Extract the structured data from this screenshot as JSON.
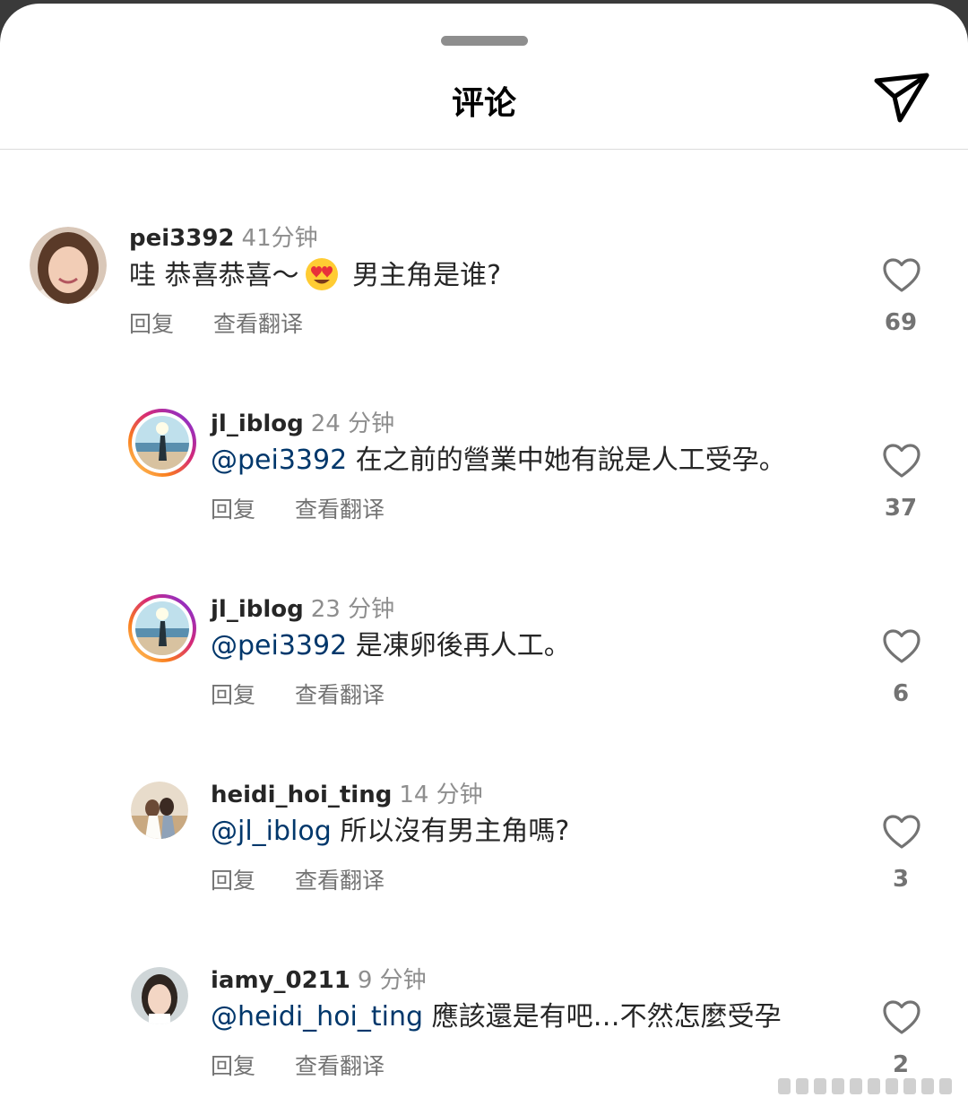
{
  "header": {
    "title": "评论",
    "send_icon": "paper-plane-icon"
  },
  "comments": [
    {
      "username": "pei3392",
      "time": "41分钟",
      "mention": "",
      "text_before_emoji": "哇 恭喜恭喜～",
      "emoji": "heart-eyes-emoji",
      "text": " 男主角是谁?",
      "reply": "回复",
      "translate": "查看翻译",
      "likes": "69",
      "avatar_ring": false
    },
    {
      "username": "jl_iblog",
      "time": "24 分钟",
      "mention": "@pei3392",
      "text": " 在之前的營業中她有說是人工受孕。",
      "reply": "回复",
      "translate": "查看翻译",
      "likes": "37",
      "avatar_ring": true
    },
    {
      "username": "jl_iblog",
      "time": "23 分钟",
      "mention": "@pei3392",
      "text": " 是凍卵後再人工。",
      "reply": "回复",
      "translate": "查看翻译",
      "likes": "6",
      "avatar_ring": true
    },
    {
      "username": "heidi_hoi_ting",
      "time": "14 分钟",
      "mention": "@jl_iblog",
      "text": " 所以沒有男主角嗎?",
      "reply": "回复",
      "translate": "查看翻译",
      "likes": "3",
      "avatar_ring": false
    },
    {
      "username": "iamy_0211",
      "time": "9 分钟",
      "mention": "@heidi_hoi_ting",
      "text": " 應該還是有吧…不然怎麼受孕",
      "reply": "回复",
      "translate": "查看翻译",
      "likes": "2",
      "avatar_ring": false
    }
  ],
  "colors": {
    "text": "#262626",
    "secondary": "#737373",
    "mention": "#00376b",
    "divider": "#dbdbdb"
  }
}
